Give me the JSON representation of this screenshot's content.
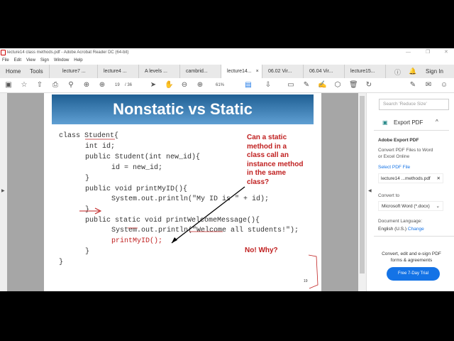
{
  "window": {
    "title": "lecture14 class methods.pdf - Adobe Acrobat Reader DC (64-bit)"
  },
  "menu": [
    "File",
    "Edit",
    "View",
    "Sign",
    "Window",
    "Help"
  ],
  "tabs": {
    "home": "Home",
    "tools": "Tools",
    "docs": [
      "lecture7 ...",
      "lecture4 ...",
      "A levels ...",
      "cambrid...",
      "lecture14...",
      "06.02 Vir...",
      "06.04 Vir...",
      "lecture15..."
    ],
    "close": "×",
    "sign_in": "Sign In"
  },
  "toolbar": {
    "page_current": "19",
    "page_total": "/ 36",
    "zoom": "61%"
  },
  "slide": {
    "title": "Nonstatic vs Static",
    "code": [
      "class Student{",
      "int id;",
      "public Student(int new_id){",
      "id = new_id;",
      "}",
      "public void printMyID(){",
      "System.out.println(\"My ID is \" + id);",
      "}",
      "public static void printWelcomeMessage(){",
      "System.out.println(\"Welcome all students!\");",
      "printMyID();",
      "}",
      "}"
    ],
    "question": [
      "Can a static",
      "method in a",
      "class call an",
      "instance method",
      "in the same",
      "class?"
    ],
    "answer": "No! Why?",
    "page_number": "19"
  },
  "right_pane": {
    "search_placeholder": "Search 'Reduce Size'",
    "export_header": "Export PDF",
    "section_title": "Adobe Export PDF",
    "description": [
      "Convert PDF Files to Word",
      "or Excel Online"
    ],
    "select_label": "Select PDF File",
    "file": "lecture14 ...methods.pdf",
    "convert_to_label": "Convert to",
    "convert_to_value": "Microsoft Word (*.docx)",
    "language_label": "Document Language:",
    "language_value": "English (U.S.)",
    "change_link": "Change",
    "promo": [
      "Convert, edit and e-sign PDF",
      "forms & agreements"
    ],
    "trial_button": "Free 7-Day Trial"
  },
  "colors": {
    "accent": "#1473e6",
    "banner": "#2e70a8",
    "annotation": "#c02020"
  }
}
